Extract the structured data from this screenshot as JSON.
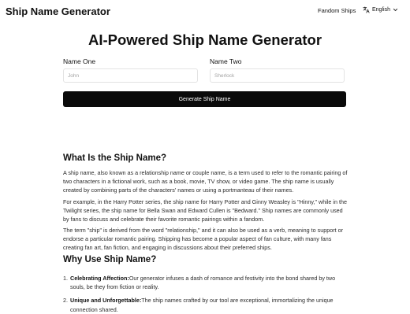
{
  "header": {
    "brand": "Ship Name Generator",
    "nav_link": "Fandom Ships",
    "language": "English",
    "language_icon": "translate-icon",
    "chevron_icon": "chevron-down-icon"
  },
  "hero": {
    "title": "AI-Powered Ship Name Generator"
  },
  "form": {
    "name_one_label": "Name One",
    "name_one_placeholder": "John",
    "name_two_label": "Name Two",
    "name_two_placeholder": "Sherlock",
    "generate_label": "Generate Ship Name"
  },
  "what": {
    "heading": "What Is the Ship Name?",
    "p1": "A ship name, also known as a relationship name or couple name, is a term used to refer to the romantic pairing of two characters in a fictional work, such as a book, movie, TV show, or video game. The ship name is usually created by combining parts of the characters' names or using a portmanteau of their names.",
    "p2": "For example, in the Harry Potter series, the ship name for Harry Potter and Ginny Weasley is \"Hinny,\" while in the Twilight series, the ship name for Bella Swan and Edward Cullen is \"Bedward.\" Ship names are commonly used by fans to discuss and celebrate their favorite romantic pairings within a fandom.",
    "p3": "The term \"ship\" is derived from the word \"relationship,\" and it can also be used as a verb, meaning to support or endorse a particular romantic pairing. Shipping has become a popular aspect of fan culture, with many fans creating fan art, fan fiction, and engaging in discussions about their preferred ships."
  },
  "why": {
    "heading": "Why Use Ship Name?",
    "items": [
      {
        "number": "1.",
        "title": "Celebrating Affection:",
        "text": "Our generator infuses a dash of romance and festivity into the bond shared by two souls, be they from fiction or reality."
      },
      {
        "number": "2.",
        "title": "Unique and Unforgettable:",
        "text": "The ship names crafted by our tool are exceptional, immortalizing the unique connection shared."
      }
    ]
  }
}
